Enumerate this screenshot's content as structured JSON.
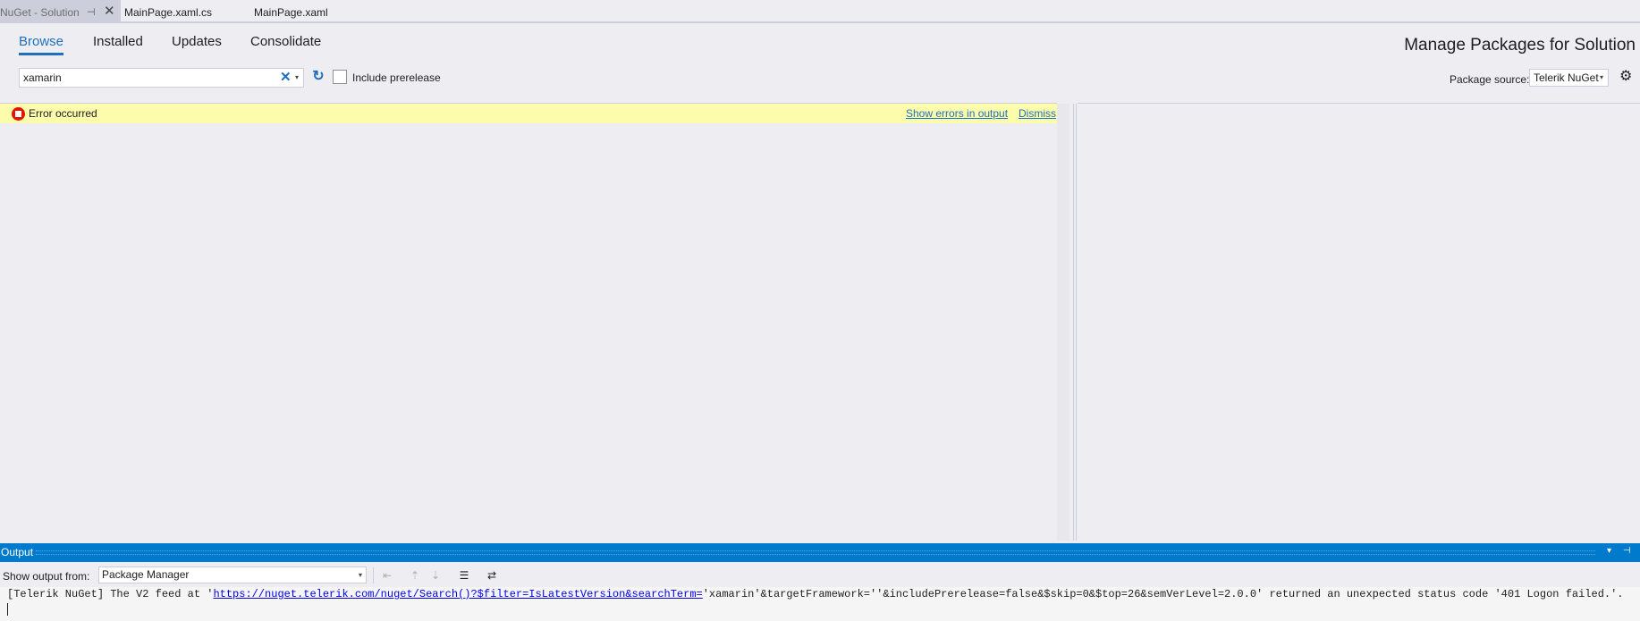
{
  "doc_tabs": {
    "active": {
      "label": "NuGet - Solution",
      "pin": "⊣",
      "close": "✕"
    },
    "others": [
      "MainPage.xaml.cs",
      "MainPage.xaml"
    ]
  },
  "nav": {
    "tabs": [
      "Browse",
      "Installed",
      "Updates",
      "Consolidate"
    ],
    "selected": "Browse",
    "title": "Manage Packages for Solution"
  },
  "search": {
    "value": "xamarin",
    "clear_icon": "✕",
    "dropdown_icon": "▾",
    "refresh_icon": "↻",
    "include_prerelease_label": "Include prerelease",
    "include_prerelease_checked": false
  },
  "package_source": {
    "label": "Package source:",
    "value": "Telerik NuGet",
    "arrow": "▾",
    "settings_icon": "⚙"
  },
  "error_bar": {
    "message": "Error occurred",
    "show_errors_link": "Show errors in output",
    "dismiss_link": "Dismiss"
  },
  "output": {
    "header": "Output",
    "header_buttons": [
      "▾",
      "⊣"
    ],
    "show_from_label": "Show output from:",
    "show_from_value": "Package Manager",
    "line_prefix": "[Telerik NuGet] The V2 feed at '",
    "line_url": "https://nuget.telerik.com/nuget/Search()?$filter=IsLatestVersion&searchTerm=",
    "line_suffix": "'xamarin'&targetFramework=''&includePrerelease=false&$skip=0&$top=26&semVerLevel=2.0.0' returned an unexpected status code '401 Logon failed.'."
  },
  "colors": {
    "accent": "#1e70bd",
    "output_header": "#007acc",
    "error_bar": "#fdfbac",
    "error_icon": "#e51400"
  }
}
